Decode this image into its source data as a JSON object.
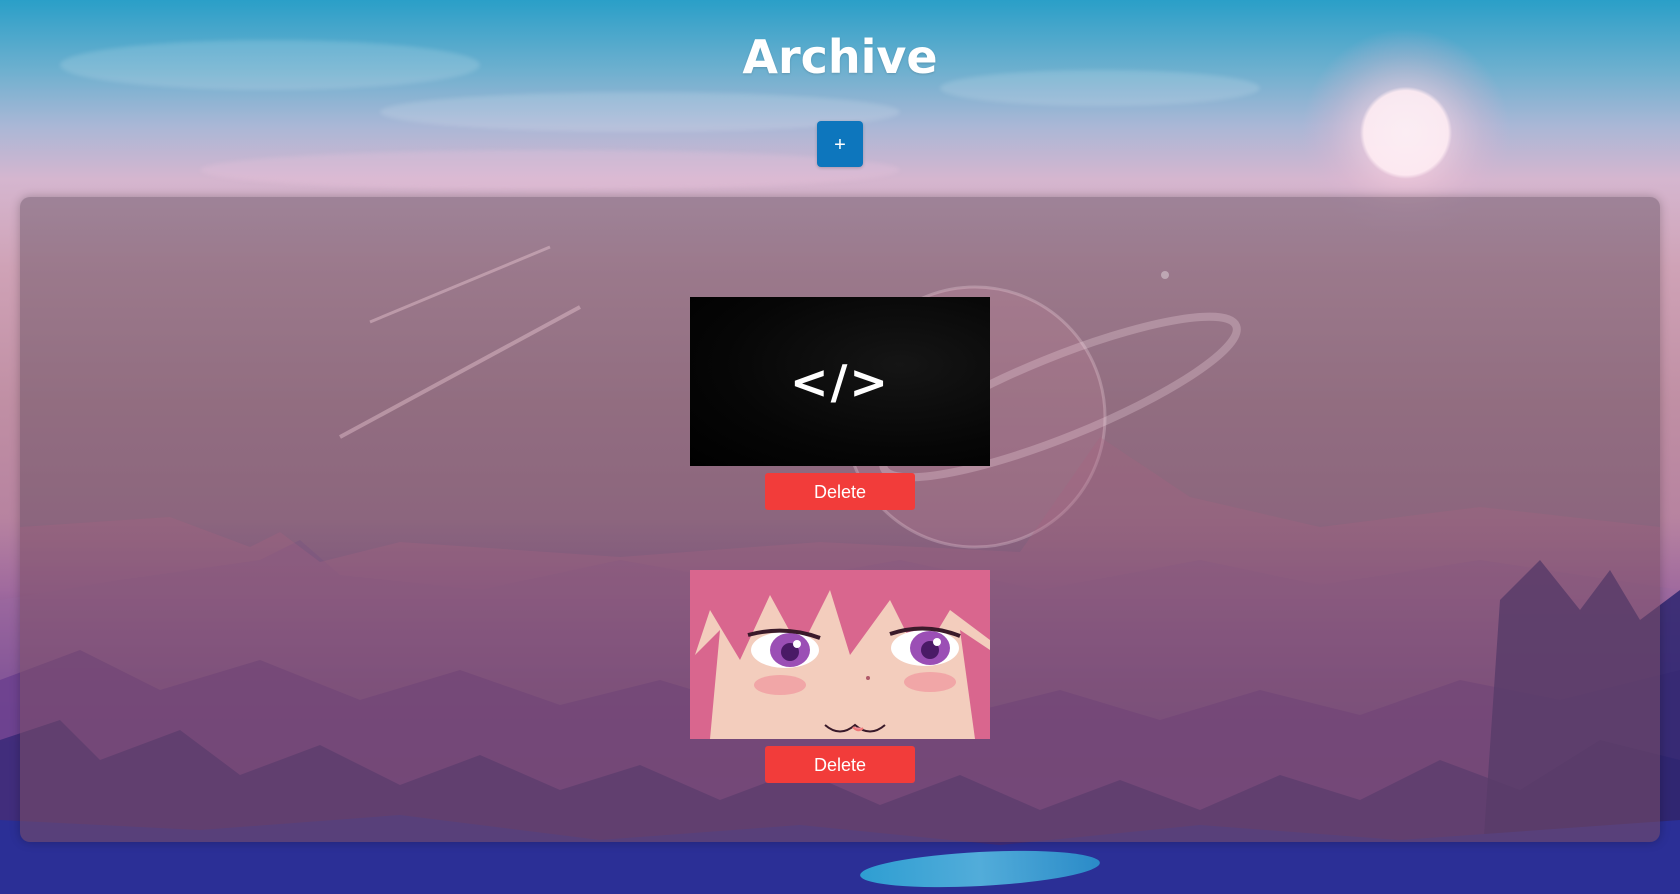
{
  "page": {
    "title": "Archive",
    "add_button_label": "+"
  },
  "archive": {
    "items": [
      {
        "thumbnail_text": "</>",
        "delete_label": "Delete"
      },
      {
        "thumbnail_text": "",
        "delete_label": "Delete"
      }
    ]
  },
  "colors": {
    "add_button": "#0d76bd",
    "delete_button": "#f23c3a",
    "title_text": "#ffffff"
  }
}
